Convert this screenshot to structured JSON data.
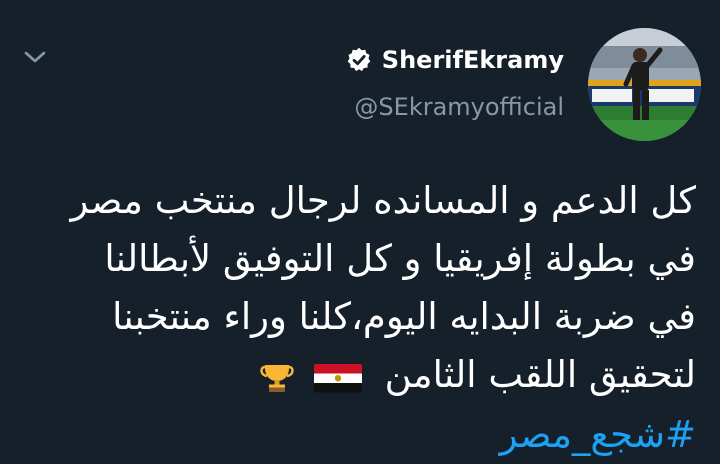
{
  "tweet": {
    "display_name": "SherifEkramy",
    "handle": "@SEkramyofficial",
    "lines": [
      "كل الدعم و المسانده لرجال منتخب مصر",
      "في بطولة إفريقيا و كل التوفيق لأبطالنا",
      "في ضربة البدايه اليوم،كلنا وراء منتخبنا",
      "لتحقيق اللقب الثامن"
    ],
    "hashtag": "#شجع_مصر",
    "emojis": [
      "egypt-flag",
      "trophy"
    ]
  },
  "colors": {
    "background": "#15202b",
    "text": "#ffffff",
    "secondary": "#8899a6",
    "link": "#1da1f2"
  },
  "icons": {
    "menu": "chevron-down-icon",
    "verified": "verified-badge-icon"
  }
}
